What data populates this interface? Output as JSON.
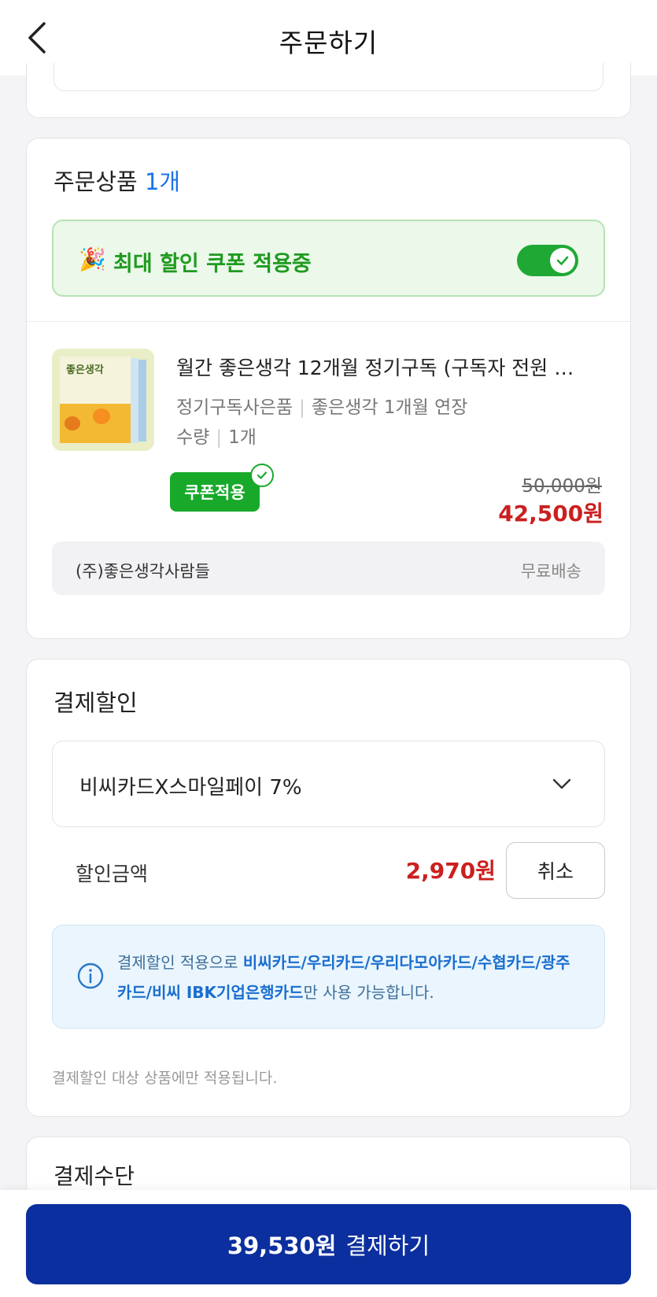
{
  "header": {
    "title": "주문하기"
  },
  "order": {
    "section_title": "주문상품",
    "count": "1개",
    "coupon_bar": {
      "label": "최대 할인 쿠폰 적용중",
      "icon": "party-popper",
      "toggle_on": true
    },
    "product": {
      "title": "월간 좋은생각 12개월 정기구독 (구독자 전원 선…",
      "thumb_title": "좋은생각",
      "gift_label": "정기구독사은품",
      "gift_value": "좋은생각 1개월 연장",
      "qty_label": "수량",
      "qty_value": "1개",
      "coupon_badge": "쿠폰적용",
      "original_price": "50,000원",
      "sale_price": "42,500원"
    },
    "seller": {
      "name": "(주)좋은생각사람들",
      "shipping": "무료배송"
    }
  },
  "payment_discount": {
    "section_title": "결제할인",
    "selected_option": "비씨카드X스마일페이 7%",
    "amount_label": "할인금액",
    "amount": "2,970원",
    "cancel_label": "취소",
    "info": {
      "prefix": "결제할인 적용으로 ",
      "cards": "비씨카드/우리카드/우리다모아카드/수협카드/광주카드/비씨 IBK기업은행카드",
      "suffix": "만 사용 가능합니다."
    },
    "note": "결제할인 대상 상품에만 적용됩니다."
  },
  "next_section": {
    "title": "결제수단"
  },
  "bottom": {
    "amount": "39,530원",
    "action": "결제하기"
  },
  "colors": {
    "primary": "#0b2f9e",
    "price_red": "#cc1f1f",
    "green": "#18a92a",
    "blue": "#1a73e8"
  }
}
